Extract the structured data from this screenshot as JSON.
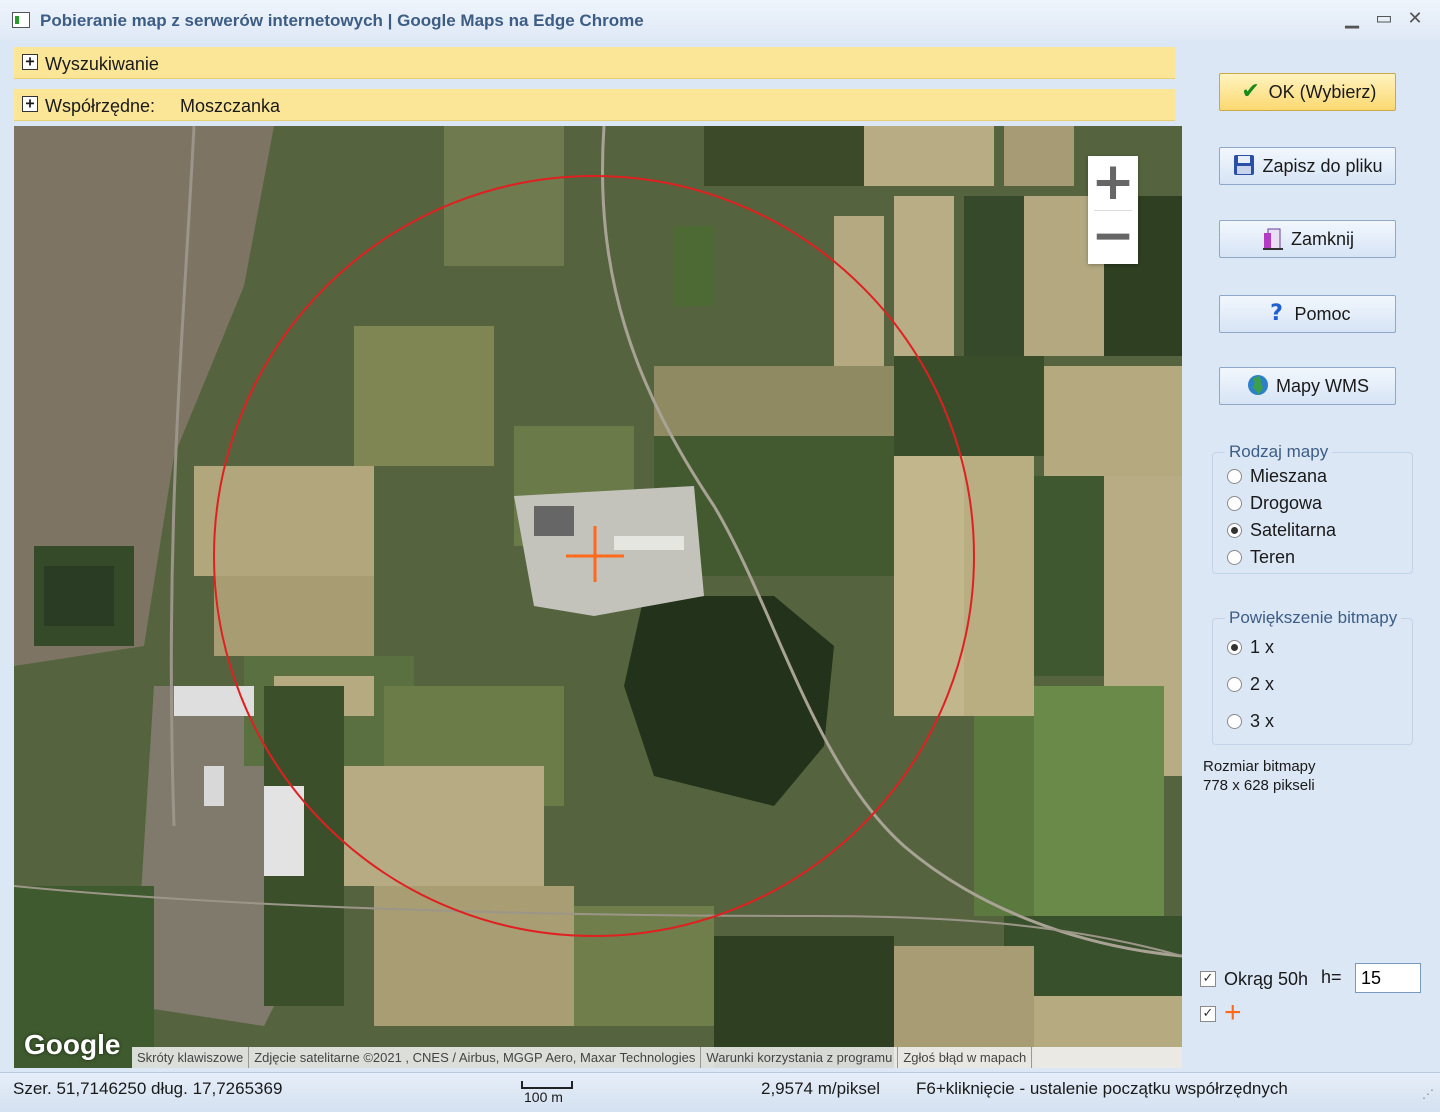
{
  "window": {
    "title": "Pobieranie map z serwerów internetowych  | Google Maps na Edge Chrome",
    "minimize": "▁",
    "maximize": "▭",
    "close": "✕"
  },
  "panels": {
    "search": {
      "expander": "+",
      "label": "Wyszukiwanie"
    },
    "coords": {
      "expander": "+",
      "label": "Współrzędne:",
      "value": "Moszczanka"
    }
  },
  "map": {
    "zoom_in": "+",
    "zoom_out": "−",
    "logo": "Google",
    "attribution": [
      "Skróty klawiszowe",
      "Zdjęcie satelitarne ©2021 , CNES / Airbus, MGGP Aero, Maxar Technologies",
      "Warunki korzystania z programu",
      "Zgłoś błąd w mapach"
    ],
    "circle_color": "#e02020",
    "crosshair_color": "#ff6a1a"
  },
  "buttons": {
    "ok": "OK (Wybierz)",
    "save": "Zapisz do pliku",
    "close": "Zamknij",
    "help": "Pomoc",
    "wms": "Mapy WMS"
  },
  "map_type": {
    "title": "Rodzaj mapy",
    "options": [
      "Mieszana",
      "Drogowa",
      "Satelitarna",
      "Teren"
    ],
    "selected": "Satelitarna"
  },
  "zoom_bitmap": {
    "title": "Powiększenie bitmapy",
    "options": [
      "1 x",
      "2 x",
      "3 x"
    ],
    "selected": "1 x"
  },
  "bitmap_size": {
    "label": "Rozmiar bitmapy",
    "value": "778 x 628 pikseli"
  },
  "circle_option": {
    "checked": true,
    "label": "Okrąg 50h",
    "h_label": "h=",
    "h_value": "15"
  },
  "cross_option": {
    "checked": true,
    "glyph": "+"
  },
  "status": {
    "coords": "Szer. 51,7146250 dług. 17,7265369",
    "scale": "100 m",
    "resolution": "2,9574 m/piksel",
    "hint": "F6+kliknięcie - ustalenie początku współrzędnych",
    "grip": "⋰"
  }
}
